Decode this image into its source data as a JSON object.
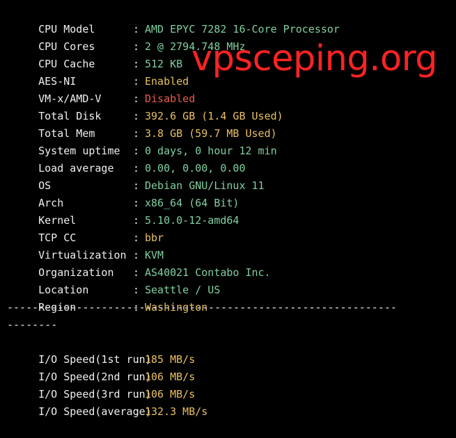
{
  "colors": {
    "background": "#000000",
    "label": "#f0f0f0",
    "green": "#80cfa0",
    "yellow": "#e8c060",
    "red": "#e85a4f",
    "watermark": "#ff2323"
  },
  "separator": ":",
  "rows": [
    {
      "label": "CPU Model",
      "value": "AMD EPYC 7282 16-Core Processor",
      "color": "#80cfa0"
    },
    {
      "label": "CPU Cores",
      "value": "2 @ 2794.748 MHz",
      "color": "#80cfa0"
    },
    {
      "label": "CPU Cache",
      "value": "512 KB",
      "color": "#80cfa0"
    },
    {
      "label": "AES-NI",
      "value": "Enabled",
      "color": "#e8c060"
    },
    {
      "label": "VM-x/AMD-V",
      "value": "Disabled",
      "color": "#e85a4f"
    },
    {
      "label": "Total Disk",
      "value": "392.6 GB (1.4 GB Used)",
      "color": "#e8c060"
    },
    {
      "label": "Total Mem",
      "value": "3.8 GB (59.7 MB Used)",
      "color": "#e8c060"
    },
    {
      "label": "System uptime",
      "value": "0 days, 0 hour 12 min",
      "color": "#80cfa0"
    },
    {
      "label": "Load average",
      "value": "0.00, 0.00, 0.00",
      "color": "#80cfa0"
    },
    {
      "label": "OS",
      "value": "Debian GNU/Linux 11",
      "color": "#80cfa0"
    },
    {
      "label": "Arch",
      "value": "x86_64 (64 Bit)",
      "color": "#80cfa0"
    },
    {
      "label": "Kernel",
      "value": "5.10.0-12-amd64",
      "color": "#80cfa0"
    },
    {
      "label": "TCP CC",
      "value": "bbr",
      "color": "#e8c060"
    },
    {
      "label": "Virtualization",
      "value": "KVM",
      "color": "#80cfa0"
    },
    {
      "label": "Organization",
      "value": "AS40021 Contabo Inc.",
      "color": "#80cfa0"
    },
    {
      "label": "Location",
      "value": "Seattle / US",
      "color": "#80cfa0"
    },
    {
      "label": "Region",
      "value": "Washington",
      "color": "#e8c060"
    }
  ],
  "divider": {
    "line1": "--------------------------------------------------------------",
    "line2": "--------"
  },
  "io_rows": [
    {
      "label": "I/O Speed(1st run)",
      "value": "185 MB/s",
      "color": "#e8c060"
    },
    {
      "label": "I/O Speed(2nd run)",
      "value": "106 MB/s",
      "color": "#e8c060"
    },
    {
      "label": "I/O Speed(3rd run)",
      "value": "106 MB/s",
      "color": "#e8c060"
    },
    {
      "label": "I/O Speed(average)",
      "value": "132.3 MB/s",
      "color": "#e8c060"
    }
  ],
  "watermark": "vpsceping.org"
}
